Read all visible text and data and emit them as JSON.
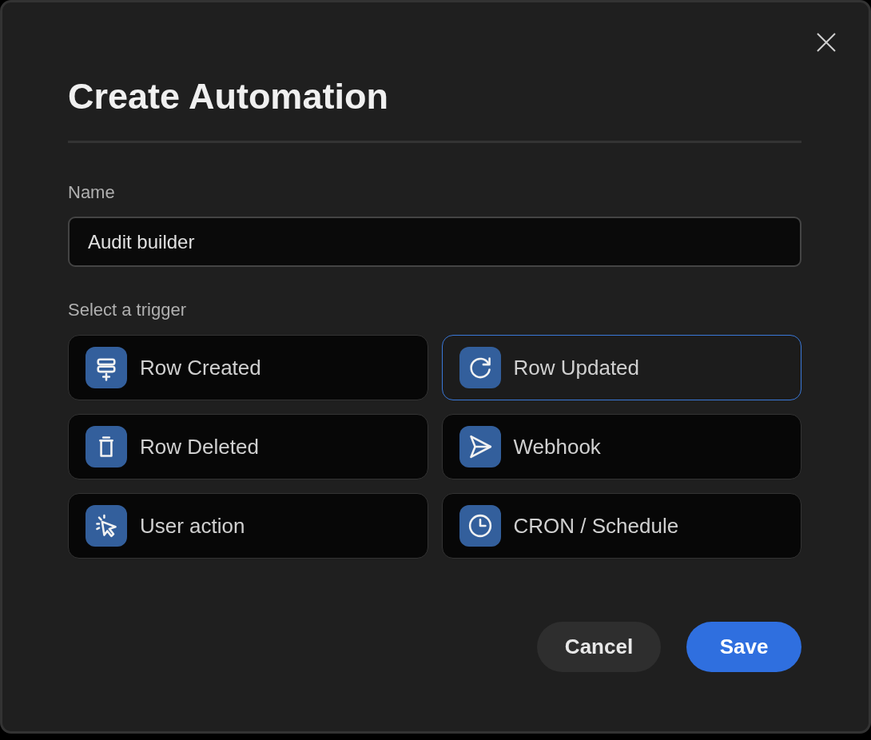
{
  "dialog": {
    "title": "Create Automation"
  },
  "name_field": {
    "label": "Name",
    "value": "Audit builder"
  },
  "trigger_section": {
    "label": "Select a trigger",
    "triggers": [
      {
        "label": "Row Created",
        "selected": false
      },
      {
        "label": "Row Updated",
        "selected": true
      },
      {
        "label": "Row Deleted",
        "selected": false
      },
      {
        "label": "Webhook",
        "selected": false
      },
      {
        "label": "User action",
        "selected": false
      },
      {
        "label": "CRON / Schedule",
        "selected": false
      }
    ]
  },
  "buttons": [
    {
      "label": "Cancel",
      "kind": "secondary"
    },
    {
      "label": "Save",
      "kind": "primary"
    }
  ]
}
